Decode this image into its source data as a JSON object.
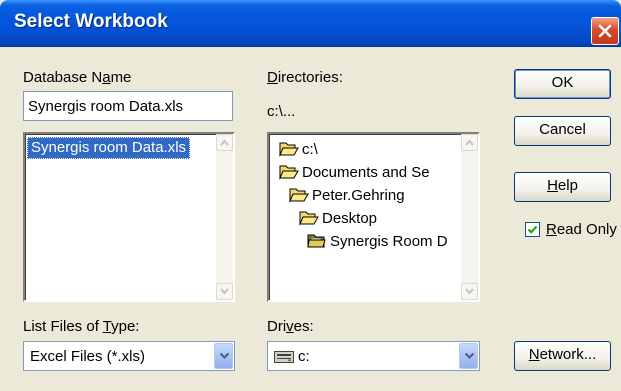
{
  "dialog": {
    "title": "Select Workbook"
  },
  "database_name": {
    "label_pre": "Database N",
    "label_key": "a",
    "label_post": "me",
    "value": "Synergis room Data.xls",
    "files": [
      "Synergis room Data.xls"
    ],
    "selected_file": "Synergis room Data.xls"
  },
  "directories": {
    "label_pre": "",
    "label_key": "D",
    "label_post": "irectories:",
    "current_path": "c:\\...",
    "items": [
      {
        "label": "c:\\",
        "icon": "open-folder-icon"
      },
      {
        "label": "Documents and Se",
        "icon": "open-folder-icon"
      },
      {
        "label": "Peter.Gehring",
        "icon": "open-folder-icon"
      },
      {
        "label": "Desktop",
        "icon": "open-folder-icon"
      },
      {
        "label": "Synergis Room D",
        "icon": "open-folder-icon"
      }
    ]
  },
  "buttons": {
    "ok": "OK",
    "cancel": "Cancel",
    "help_key": "H",
    "help_post": "elp",
    "network_key": "N",
    "network_post": "etwork..."
  },
  "read_only": {
    "label_key": "R",
    "label_post": "ead Only",
    "checked": true
  },
  "file_type": {
    "label_pre": "List Files of ",
    "label_key": "T",
    "label_post": "ype:",
    "selected": "Excel Files (*.xls)"
  },
  "drives": {
    "label_pre": "Dri",
    "label_key": "v",
    "label_post": "es:",
    "selected": "c:",
    "icon": "drive-icon"
  }
}
